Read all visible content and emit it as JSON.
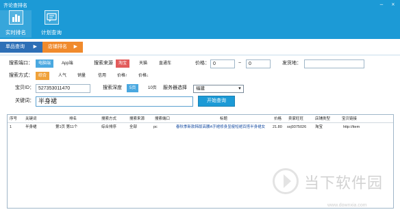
{
  "window": {
    "title": "齐论查排名",
    "minimize": "–",
    "close": "×"
  },
  "nav": [
    {
      "label": "实时排名",
      "icon": "bar-chart-icon",
      "active": true
    },
    {
      "label": "计划查询",
      "icon": "chat-bubble-icon",
      "active": false
    }
  ],
  "modes": {
    "single": "单品查询",
    "shop": "店铺排名",
    "arrow": "▶"
  },
  "search_port": {
    "label": "搜索端口：",
    "options": [
      "电脑端",
      "App端"
    ],
    "selected": "电脑端"
  },
  "search_source": {
    "label": "搜索来源",
    "options": [
      "淘宝",
      "天猫",
      "直通车"
    ],
    "selected": "淘宝"
  },
  "price": {
    "label": "价格：",
    "min": "0",
    "separator": "~",
    "max": "0"
  },
  "ship_from": {
    "label": "发货地：",
    "value": ""
  },
  "search_mode": {
    "label": "搜索方式：",
    "options": [
      "综合",
      "人气",
      "销量",
      "信用",
      "价格↑",
      "价格↓"
    ],
    "selected": "综合"
  },
  "item_id": {
    "label": "宝贝ID：",
    "value": "527353011470"
  },
  "depth": {
    "label": "搜索深度",
    "options": [
      "5页",
      "10页"
    ],
    "selected": "5页"
  },
  "server": {
    "label": "服务器选择",
    "value": "福建",
    "caret": "▼"
  },
  "keyword": {
    "label": "关键词：",
    "value": "半身裙"
  },
  "start_button": "开始查询",
  "table": {
    "columns": [
      "序号",
      "关键词",
      "排名",
      "搜索方式",
      "搜索来源",
      "搜索端口",
      "标题",
      "价格",
      "卖家旺旺",
      "店铺类型",
      "宝贝链接"
    ],
    "rows": [
      [
        "1",
        "半身裙",
        "第1页 第11个",
        "综合排序",
        "全部",
        "pc",
        "春秋季新款韩版高腰A字裙修身显瘦短裙百搭半身裙女",
        "21.80",
        "sxj9375026",
        "淘宝",
        "http://item"
      ]
    ]
  },
  "watermark": {
    "text": "当下软件园",
    "url": "www.downxia.com"
  },
  "colors": {
    "primary_blue": "#1c9ad6",
    "active_tab_blue": "#2d6fb6",
    "shop_tab_orange": "#f08a2c",
    "selected_red": "#e25b5b",
    "selected_blue": "#4aa8e0",
    "selected_orange": "#f0a23a"
  }
}
